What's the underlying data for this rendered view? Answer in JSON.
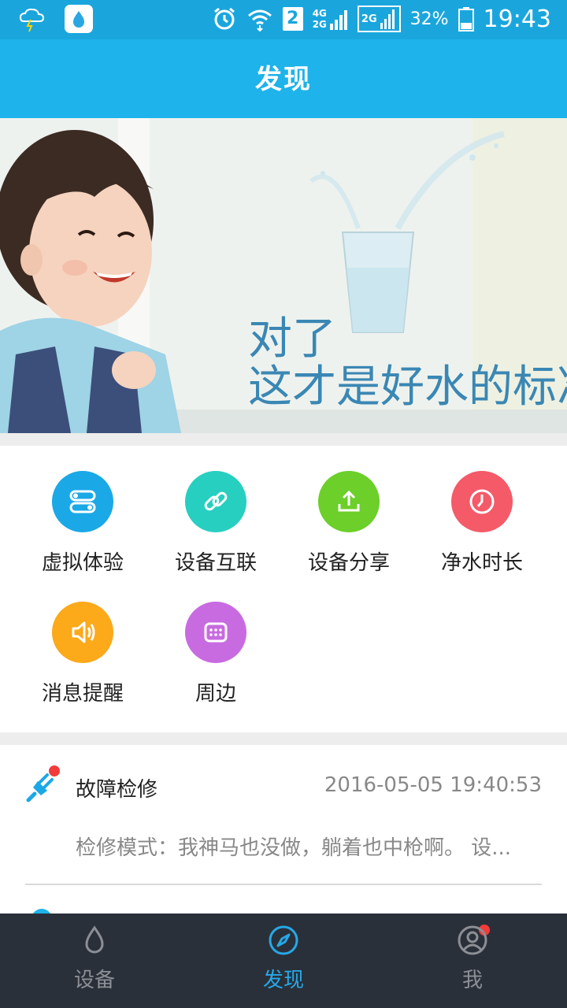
{
  "status_bar": {
    "network_top": "4G",
    "network_bottom": "2G",
    "network2": "2G",
    "sim_badge": "2",
    "battery": "32%",
    "time": "19:43"
  },
  "header": {
    "title": "发现"
  },
  "banner": {
    "line1": "对了",
    "line2": "这才是好水的标准"
  },
  "features": [
    {
      "label": "虚拟体验",
      "icon": "toggle-icon",
      "color": "#1ba8e6"
    },
    {
      "label": "设备互联",
      "icon": "link-icon",
      "color": "#27cfc0"
    },
    {
      "label": "设备分享",
      "icon": "upload-icon",
      "color": "#6ccf2a"
    },
    {
      "label": "净水时长",
      "icon": "clock-icon",
      "color": "#f45a68"
    },
    {
      "label": "消息提醒",
      "icon": "speaker-icon",
      "color": "#fca91a"
    },
    {
      "label": "周边",
      "icon": "keypad-icon",
      "color": "#c86be0"
    }
  ],
  "messages": [
    {
      "icon": "plug-icon",
      "title": "故障检修",
      "time": "2016-05-05 19:40:53",
      "desc": "检修模式：我神马也没做，躺着也中枪啊。 设..."
    }
  ],
  "bottom_nav": [
    {
      "label": "设备",
      "icon": "water-drop-icon",
      "active": false
    },
    {
      "label": "发现",
      "icon": "compass-icon",
      "active": true
    },
    {
      "label": "我",
      "icon": "user-icon",
      "active": false
    }
  ],
  "colors": {
    "header": "#1eb3ea",
    "status_bar": "#1aa6dd",
    "nav_bg": "#2a3039",
    "nav_active": "#26a8e8",
    "badge": "#f23b3b"
  }
}
